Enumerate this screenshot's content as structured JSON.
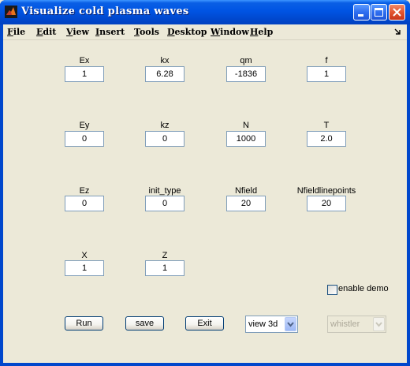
{
  "window": {
    "title": "Visualize cold plasma waves"
  },
  "menu": {
    "items": [
      "File",
      "Edit",
      "View",
      "Insert",
      "Tools",
      "Desktop",
      "Window",
      "Help"
    ]
  },
  "params": [
    {
      "label": "Ex",
      "value": "1"
    },
    {
      "label": "kx",
      "value": "6.28"
    },
    {
      "label": "qm",
      "value": "-1836"
    },
    {
      "label": "f",
      "value": "1"
    },
    {
      "label": "Ey",
      "value": "0"
    },
    {
      "label": "kz",
      "value": "0"
    },
    {
      "label": "N",
      "value": "1000"
    },
    {
      "label": "T",
      "value": "2.0"
    },
    {
      "label": "Ez",
      "value": "0"
    },
    {
      "label": "init_type",
      "value": "0"
    },
    {
      "label": "Nfield",
      "value": "20"
    },
    {
      "label": "Nfieldlinepoints",
      "value": "20"
    },
    {
      "label": "X",
      "value": "1"
    },
    {
      "label": "Z",
      "value": "1"
    }
  ],
  "demo": {
    "label": "enable demo",
    "checked": false
  },
  "buttons": {
    "run": "Run",
    "save": "save",
    "exit": "Exit"
  },
  "view_select": {
    "value": "view 3d"
  },
  "wave_select": {
    "value": "whistler",
    "disabled": true
  },
  "icons": {
    "app": "matlab-icon",
    "minimize": "minimize-icon",
    "maximize": "maximize-icon",
    "close": "close-icon",
    "dock": "dock-arrow-icon",
    "dropdown": "chevron-down-icon"
  }
}
